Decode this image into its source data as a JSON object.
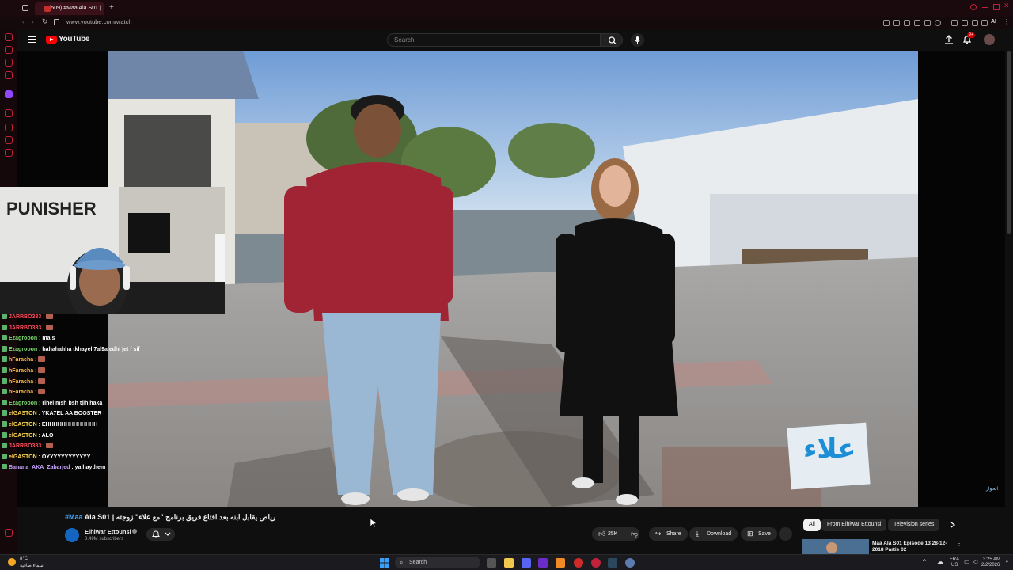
{
  "browser": {
    "tab_title": "(509) #Maa Ala S01 |",
    "url": "www.youtube.com/watch",
    "menu_label": "AI"
  },
  "youtube": {
    "logo_text": "YouTube",
    "search_placeholder": "Search",
    "notification_count": "9+"
  },
  "video": {
    "title_hashtag": "#Maa",
    "title_rest": "Ala S01 | رياض يقابل ابنه بعد اقتاع فريق برنامج \"مع علاء\" زوجته",
    "channel_name": "Elhiwar Ettounsi",
    "subscribers": "8.49M subscribers",
    "likes": "25K",
    "share_label": "Share",
    "download_label": "Download",
    "save_label": "Save",
    "watermark_text": "علاء",
    "corner_brand": "الحوار"
  },
  "sidebar": {
    "chips": [
      "All",
      "From Elhiwar Ettounsi",
      "Television series"
    ],
    "next_video_title": "Maa Ala S01 Episode 13 28-12-2018 Partie 02"
  },
  "chat": [
    {
      "user": "JARRBO333",
      "color": "#ff4b5c",
      "msg": "",
      "emote": true
    },
    {
      "user": "JARRBO333",
      "color": "#ff4b5c",
      "msg": "",
      "emote": true
    },
    {
      "user": "Ezagrooon",
      "color": "#7bd96e",
      "msg": "mais",
      "emote": false
    },
    {
      "user": "Ezagrooon",
      "color": "#7bd96e",
      "msg": "hahahahha tkhayel 7al9a edhi jet f sif",
      "emote": false
    },
    {
      "user": "hFaracha",
      "color": "#ffb84d",
      "msg": "",
      "emote": true
    },
    {
      "user": "hFaracha",
      "color": "#ffb84d",
      "msg": "",
      "emote": true
    },
    {
      "user": "hFaracha",
      "color": "#ffb84d",
      "msg": "",
      "emote": true
    },
    {
      "user": "hFaracha",
      "color": "#ffb84d",
      "msg": "",
      "emote": true
    },
    {
      "user": "Ezagrooon",
      "color": "#7bd96e",
      "msg": "rihel msh bsh tjih haka",
      "emote": false
    },
    {
      "user": "elGASTON",
      "color": "#ffd94d",
      "msg": "YKA7EL AA BOOSTER",
      "emote": false
    },
    {
      "user": "elGASTON",
      "color": "#ffd94d",
      "msg": "EHHHHHHHHHHHHH",
      "emote": false
    },
    {
      "user": "elGASTON",
      "color": "#ffd94d",
      "msg": "ALO",
      "emote": false
    },
    {
      "user": "JARRBO333",
      "color": "#ff4b5c",
      "msg": "",
      "emote": true
    },
    {
      "user": "elGASTON",
      "color": "#ffd94d",
      "msg": "OYYYYYYYYYYYY",
      "emote": false
    },
    {
      "user": "Banana_AKA_Zabarjed",
      "color": "#c8a6ff",
      "msg": "ya haythem",
      "emote": false
    }
  ],
  "taskbar": {
    "weather_temp": "8°C",
    "weather_desc": "سماء صافية",
    "search_label": "Search",
    "lang_top": "FRA",
    "lang_bottom": "US",
    "time": "3:25 AM",
    "date": "2/2/2026"
  },
  "colors": {
    "accent_red": "#ff0000",
    "link_blue": "#3ea6ff",
    "opera_red": "#c0213b"
  }
}
